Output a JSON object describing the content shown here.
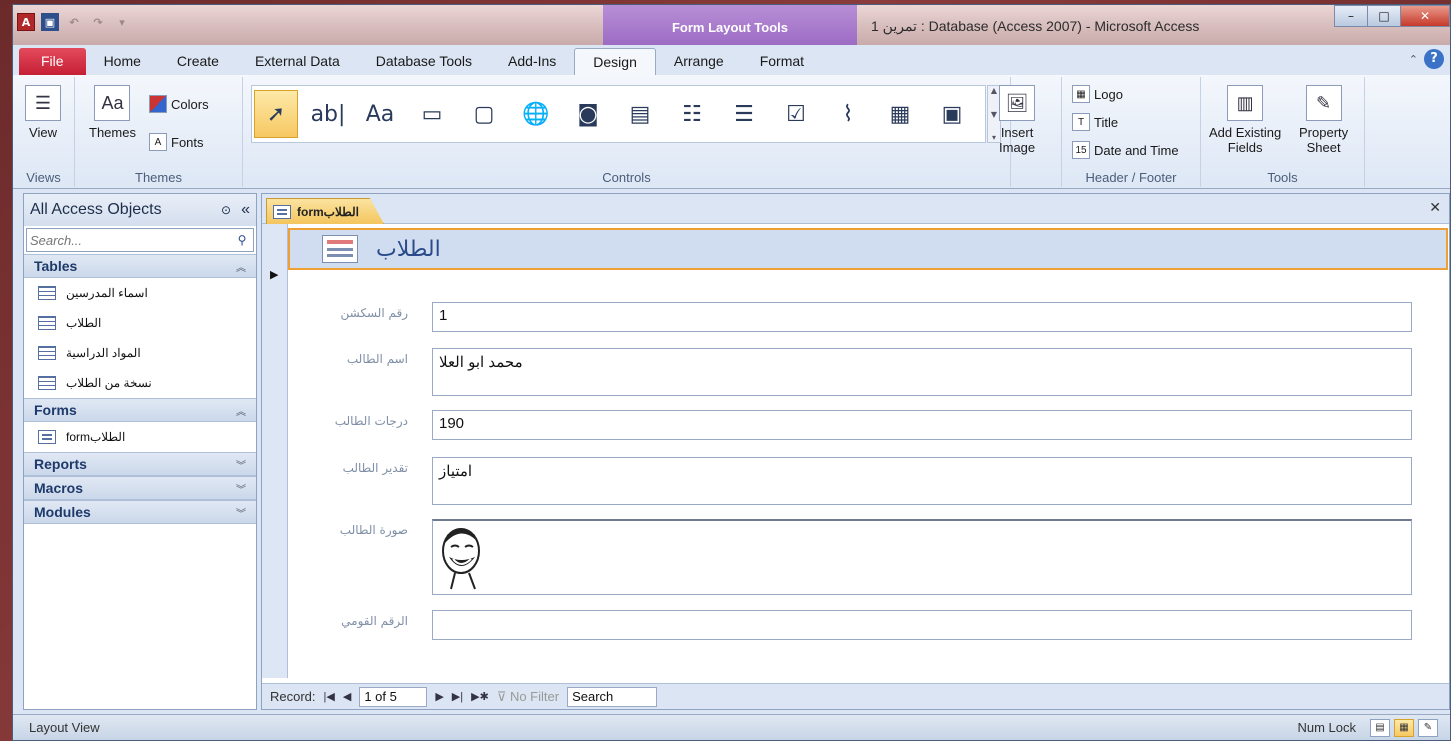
{
  "window": {
    "title": "تمرين 1 : Database (Access 2007) - Microsoft Access",
    "context_tab_group": "Form Layout Tools",
    "controls": {
      "minimize": "–",
      "maximize": "□",
      "close": "✕"
    }
  },
  "ribbon_tabs": [
    "File",
    "Home",
    "Create",
    "External Data",
    "Database Tools",
    "Add-Ins",
    "Design",
    "Arrange",
    "Format"
  ],
  "active_tab": "Design",
  "ribbon": {
    "views": {
      "view_label": "View",
      "group_label": "Views"
    },
    "themes": {
      "themes_label": "Themes",
      "colors_label": "Colors",
      "fonts_label": "Fonts",
      "group_label": "Themes"
    },
    "controls": {
      "group_label": "Controls"
    },
    "insert_image": {
      "label_line1": "Insert",
      "label_line2": "Image"
    },
    "header_footer": {
      "logo": "Logo",
      "title": "Title",
      "date_time": "Date and Time",
      "group_label": "Header / Footer"
    },
    "tools": {
      "add_fields_line1": "Add Existing",
      "add_fields_line2": "Fields",
      "property_line1": "Property",
      "property_line2": "Sheet",
      "group_label": "Tools"
    }
  },
  "nav_pane": {
    "title": "All Access Objects",
    "search_placeholder": "Search...",
    "categories": {
      "tables": {
        "label": "Tables",
        "items": [
          "اسماء المدرسين",
          "الطلاب",
          "المواد الدراسية",
          "نسخة من الطلاب"
        ]
      },
      "forms": {
        "label": "Forms",
        "items": [
          "formالطلاب"
        ]
      },
      "reports": {
        "label": "Reports"
      },
      "macros": {
        "label": "Macros"
      },
      "modules": {
        "label": "Modules"
      }
    }
  },
  "document": {
    "tab_label": "formالطلاب",
    "form_title": "الطلاب",
    "fields": [
      {
        "label": "رقم السكشن",
        "value": "1"
      },
      {
        "label": "اسم الطالب",
        "value": "محمد ابو العلا"
      },
      {
        "label": "درجات الطالب",
        "value": "190"
      },
      {
        "label": "تقدير الطالب",
        "value": "امتياز"
      },
      {
        "label": "صورة الطالب",
        "value": ""
      },
      {
        "label": "الرقم القومي",
        "value": ""
      }
    ],
    "record_nav": {
      "label": "Record:",
      "position": "1 of 5",
      "filter": "No Filter",
      "search": "Search"
    }
  },
  "status_bar": {
    "view": "Layout View",
    "numlock": "Num Lock"
  }
}
